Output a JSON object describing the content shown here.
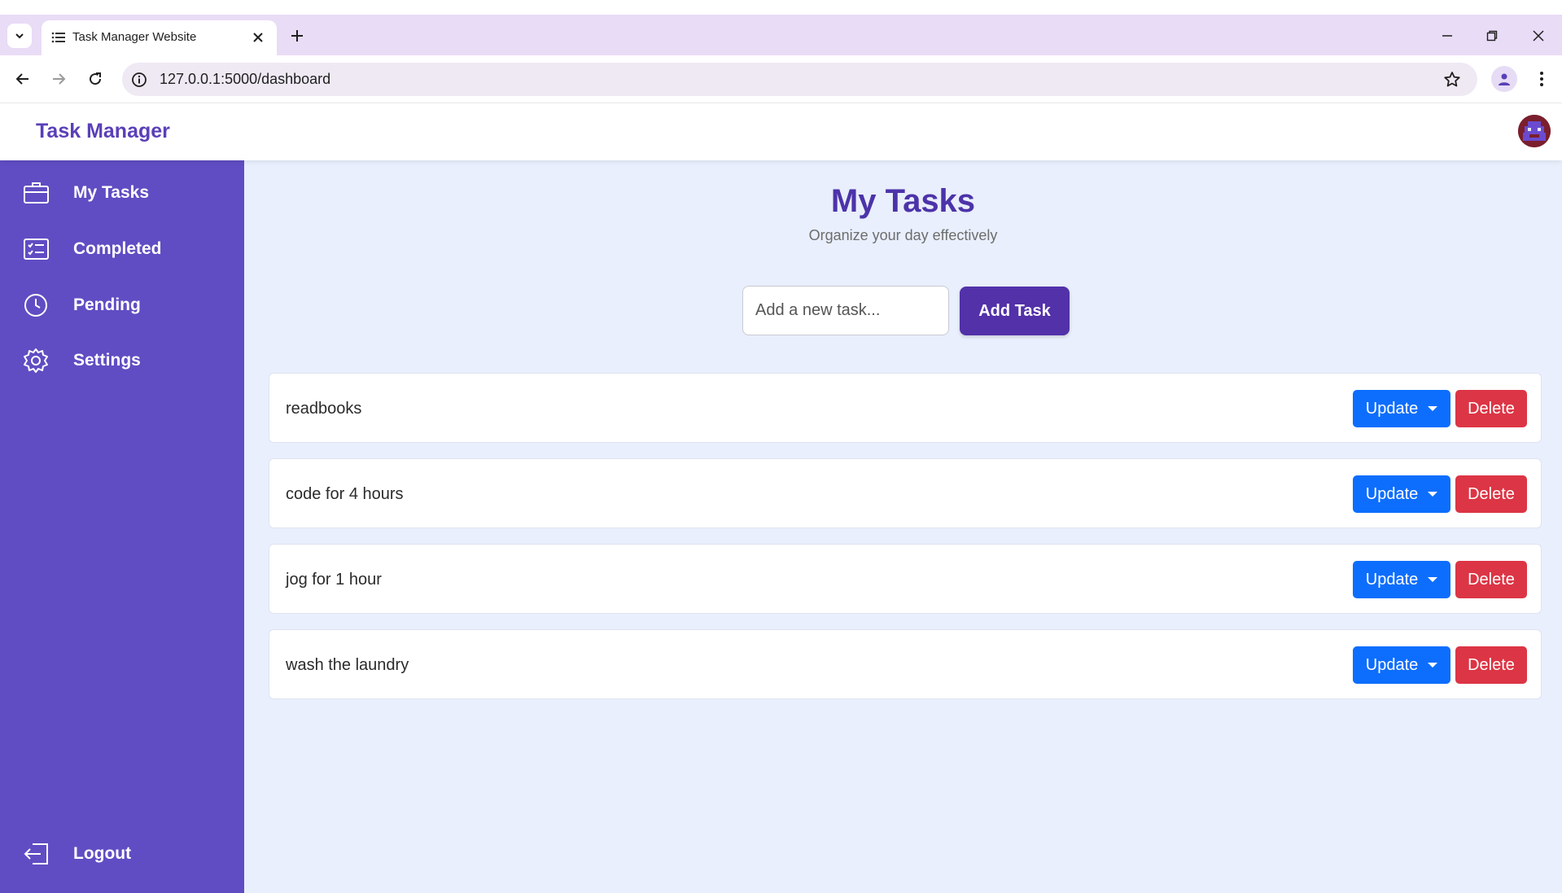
{
  "browser": {
    "tab_title": "Task Manager Website",
    "url": "127.0.0.1:5000/dashboard"
  },
  "app": {
    "brand": "Task Manager",
    "avatar_icon": "pixel-avatar-icon"
  },
  "sidebar": {
    "items": [
      {
        "label": "My Tasks",
        "icon": "briefcase-icon"
      },
      {
        "label": "Completed",
        "icon": "checklist-icon"
      },
      {
        "label": "Pending",
        "icon": "clock-icon"
      },
      {
        "label": "Settings",
        "icon": "gear-icon"
      }
    ],
    "logout": {
      "label": "Logout",
      "icon": "logout-icon"
    }
  },
  "main": {
    "title": "My Tasks",
    "subtitle": "Organize your day effectively",
    "input_placeholder": "Add a new task...",
    "add_button": "Add Task",
    "tasks": [
      {
        "text": "readbooks",
        "update_label": "Update",
        "delete_label": "Delete"
      },
      {
        "text": "code for 4 hours",
        "update_label": "Update",
        "delete_label": "Delete"
      },
      {
        "text": "jog for 1 hour",
        "update_label": "Update",
        "delete_label": "Delete"
      },
      {
        "text": "wash the laundry",
        "update_label": "Update",
        "delete_label": "Delete"
      }
    ]
  },
  "colors": {
    "sidebar": "#604dc3",
    "brand": "#5a3fb8",
    "title": "#4c33a9",
    "add_button": "#5231a9",
    "update_button": "#0d6efd",
    "delete_button": "#dc3545",
    "main_bg": "#e9effc"
  }
}
